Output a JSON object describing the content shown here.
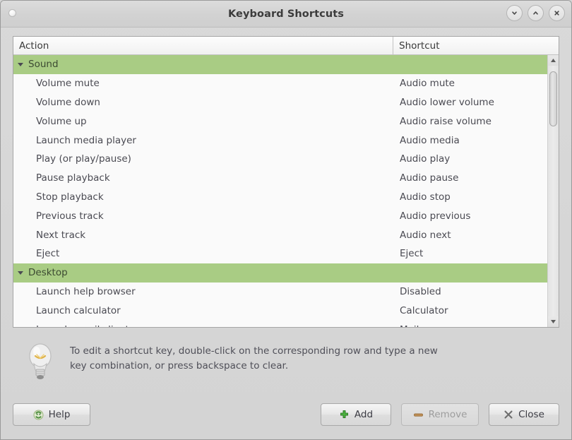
{
  "window": {
    "title": "Keyboard Shortcuts",
    "controls": [
      {
        "name": "minimize-button",
        "icon": "chevron-down-icon"
      },
      {
        "name": "maximize-button",
        "icon": "chevron-up-icon"
      },
      {
        "name": "close-button",
        "icon": "close-icon"
      }
    ]
  },
  "list": {
    "columns": {
      "action": "Action",
      "shortcut": "Shortcut"
    },
    "rows": [
      {
        "type": "group",
        "action": "Sound",
        "shortcut": "",
        "selected": true
      },
      {
        "type": "item",
        "action": "Volume mute",
        "shortcut": "Audio mute"
      },
      {
        "type": "item",
        "action": "Volume down",
        "shortcut": "Audio lower volume"
      },
      {
        "type": "item",
        "action": "Volume up",
        "shortcut": "Audio raise volume"
      },
      {
        "type": "item",
        "action": "Launch media player",
        "shortcut": "Audio media"
      },
      {
        "type": "item",
        "action": "Play (or play/pause)",
        "shortcut": "Audio play"
      },
      {
        "type": "item",
        "action": "Pause playback",
        "shortcut": "Audio pause"
      },
      {
        "type": "item",
        "action": "Stop playback",
        "shortcut": "Audio stop"
      },
      {
        "type": "item",
        "action": "Previous track",
        "shortcut": "Audio previous"
      },
      {
        "type": "item",
        "action": "Next track",
        "shortcut": "Audio next"
      },
      {
        "type": "item",
        "action": "Eject",
        "shortcut": "Eject"
      },
      {
        "type": "group",
        "action": "Desktop",
        "shortcut": "",
        "selected": false
      },
      {
        "type": "item",
        "action": "Launch help browser",
        "shortcut": "Disabled"
      },
      {
        "type": "item",
        "action": "Launch calculator",
        "shortcut": "Calculator"
      },
      {
        "type": "item",
        "action": "Launch email client",
        "shortcut": "Mail"
      }
    ]
  },
  "hint": {
    "icon": "lightbulb-icon",
    "text": "To edit a shortcut key, double-click on the corresponding row and type a new\nkey combination, or press backspace to clear."
  },
  "footer": {
    "help_label": "Help",
    "add_label": "Add",
    "remove_label": "Remove",
    "close_label": "Close",
    "remove_disabled": true
  },
  "colors": {
    "selection_green": "#a9cc84",
    "window_bg": "#d6d6d6",
    "list_bg": "#fafafa",
    "add_icon_green": "#3fae37",
    "remove_icon_brown": "#b08048"
  }
}
